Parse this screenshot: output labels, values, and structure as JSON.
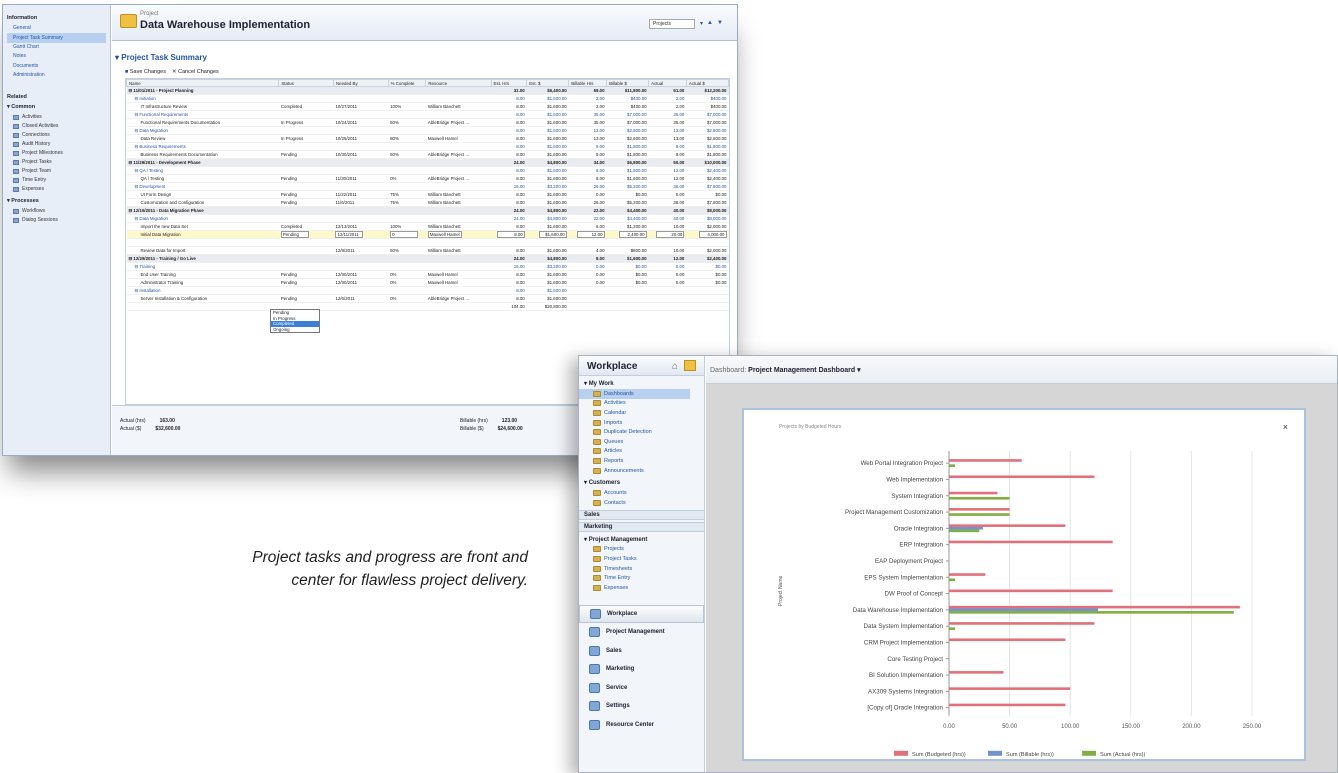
{
  "left_window": {
    "nav": {
      "information_header": "Information",
      "information_items": [
        "General",
        "Project Task Summary",
        "Gantt Chart",
        "Notes",
        "Documents",
        "Administration"
      ],
      "related_header": "Related",
      "common_header": "Common",
      "common_items": [
        "Activities",
        "Closed Activities",
        "Connections",
        "Audit History",
        "Project Milestones",
        "Project Tasks",
        "Project Team",
        "Time Entry",
        "Expenses"
      ],
      "processes_header": "Processes",
      "processes_items": [
        "Workflows",
        "Dialog Sessions"
      ]
    },
    "header": {
      "entity": "Project",
      "title": "Data Warehouse Implementation",
      "view_select": "Projects"
    },
    "section_title": "Project Task Summary",
    "toolbar": {
      "save": "Save Changes",
      "cancel": "Cancel Changes"
    },
    "columns": [
      "Name",
      "Status",
      "Needed By",
      "% Complete",
      "Resource",
      "Est. Hrs",
      "Est. $",
      "Billable Hrs",
      "Billable $",
      "Actual",
      "Actual $"
    ],
    "rows": [
      {
        "kind": "phase",
        "cells": [
          "11/01/2011 - Project Planning",
          "",
          "",
          "",
          "",
          "32.00",
          "$6,400.00",
          "59.00",
          "$11,800.00",
          "61.00",
          "$12,200.00"
        ]
      },
      {
        "kind": "group",
        "cells": [
          "Initiation",
          "",
          "",
          "",
          "",
          "8.00",
          "$1,600.00",
          "2.00",
          "$400.00",
          "2.00",
          "$400.00"
        ]
      },
      {
        "kind": "task",
        "cells": [
          "IT Infrastructure Review",
          "Completed",
          "10/27/2011",
          "100%",
          "William Banchett",
          "8.00",
          "$1,600.00",
          "2.00",
          "$400.00",
          "2.00",
          "$400.00"
        ]
      },
      {
        "kind": "group",
        "cells": [
          "Functional Requirements",
          "",
          "",
          "",
          "",
          "8.00",
          "$1,600.00",
          "35.00",
          "$7,000.00",
          "35.00",
          "$7,000.00"
        ]
      },
      {
        "kind": "task",
        "cells": [
          "Functional Requirements Documentation",
          "In Progress",
          "10/24/2011",
          "50%",
          "AbleBridge Project ...",
          "8.00",
          "$1,600.00",
          "35.00",
          "$7,000.00",
          "35.00",
          "$7,000.00"
        ]
      },
      {
        "kind": "group",
        "cells": [
          "Data Migration",
          "",
          "",
          "",
          "",
          "8.00",
          "$1,600.00",
          "13.00",
          "$2,600.00",
          "13.00",
          "$2,600.00"
        ]
      },
      {
        "kind": "task",
        "cells": [
          "Data Review",
          "In Progress",
          "10/25/2011",
          "80%",
          "Maxwell Hamel",
          "8.00",
          "$1,600.00",
          "13.00",
          "$2,600.00",
          "13.00",
          "$2,600.00"
        ]
      },
      {
        "kind": "group",
        "cells": [
          "Business Requirements",
          "",
          "",
          "",
          "",
          "8.00",
          "$1,600.00",
          "9.00",
          "$1,800.00",
          "9.00",
          "$1,800.00"
        ]
      },
      {
        "kind": "task",
        "cells": [
          "Business Requirements Documentation",
          "Pending",
          "10/30/2011",
          "50%",
          "AbleBridge Project ...",
          "8.00",
          "$1,600.00",
          "9.00",
          "$1,800.00",
          "9.00",
          "$1,800.00"
        ]
      },
      {
        "kind": "phase",
        "cells": [
          "11/29/2011 - Development Phase",
          "",
          "",
          "",
          "",
          "24.00",
          "$4,800.00",
          "34.00",
          "$6,800.00",
          "50.00",
          "$10,000.00"
        ]
      },
      {
        "kind": "group",
        "cells": [
          "QA / Testing",
          "",
          "",
          "",
          "",
          "8.00",
          "$1,600.00",
          "8.00",
          "$1,600.00",
          "12.00",
          "$2,400.00"
        ]
      },
      {
        "kind": "task",
        "cells": [
          "QA / Testing",
          "Pending",
          "11/30/2011",
          "0%",
          "AbleBridge Project ...",
          "8.00",
          "$1,600.00",
          "8.00",
          "$1,600.00",
          "12.00",
          "$2,400.00"
        ]
      },
      {
        "kind": "group",
        "cells": [
          "Development",
          "",
          "",
          "",
          "",
          "16.00",
          "$3,200.00",
          "26.00",
          "$5,200.00",
          "38.00",
          "$7,600.00"
        ]
      },
      {
        "kind": "task",
        "cells": [
          "UI Form Design",
          "Pending",
          "11/22/2011",
          "75%",
          "William Banchett",
          "8.00",
          "$1,600.00",
          "0.00",
          "$0.00",
          "0.00",
          "$0.00"
        ]
      },
      {
        "kind": "task",
        "cells": [
          "Customization and Configuration",
          "Pending",
          "11/6/2011",
          "75%",
          "William Banchett",
          "8.00",
          "$1,600.00",
          "26.00",
          "$5,200.00",
          "38.00",
          "$7,600.00"
        ]
      },
      {
        "kind": "phase",
        "cells": [
          "12/15/2011 - Data Migration Phase",
          "",
          "",
          "",
          "",
          "24.00",
          "$4,800.00",
          "22.00",
          "$4,400.00",
          "40.00",
          "$8,000.00"
        ]
      },
      {
        "kind": "group",
        "cells": [
          "Data Migration",
          "",
          "",
          "",
          "",
          "24.00",
          "$4,800.00",
          "22.00",
          "$4,400.00",
          "40.00",
          "$8,000.00"
        ]
      },
      {
        "kind": "task",
        "cells": [
          "Import the new Data Set",
          "Completed",
          "12/13/2011",
          "100%",
          "William Banchett",
          "8.00",
          "$1,600.00",
          "6.00",
          "$1,200.00",
          "10.00",
          "$2,000.00"
        ]
      },
      {
        "kind": "edit",
        "cells": [
          "Initial Data Migration",
          "Pending",
          "12/11/2011",
          "0",
          "Maxwell Hamel",
          "8.00",
          "$1,600.00",
          "12.00",
          "2,400.00",
          "20.00",
          "4,000.00"
        ]
      },
      {
        "kind": "blank",
        "cells": [
          "",
          "",
          "",
          "",
          "",
          "",
          "",
          "",
          "",
          "",
          ""
        ]
      },
      {
        "kind": "task",
        "cells": [
          "Review Data for Import",
          "",
          "12/8/2011",
          "50%",
          "William Banchett",
          "8.00",
          "$1,600.00",
          "4.00",
          "$800.00",
          "10.00",
          "$2,000.00"
        ]
      },
      {
        "kind": "phase",
        "cells": [
          "12/29/2011 - Training / Go Live",
          "",
          "",
          "",
          "",
          "24.00",
          "$4,800.00",
          "8.00",
          "$1,600.00",
          "12.00",
          "$2,400.00"
        ]
      },
      {
        "kind": "group",
        "cells": [
          "Training",
          "",
          "",
          "",
          "",
          "16.00",
          "$3,200.00",
          "0.00",
          "$0.00",
          "0.00",
          "$0.00"
        ]
      },
      {
        "kind": "task",
        "cells": [
          "End User Training",
          "Pending",
          "12/30/2011",
          "0%",
          "Maxwell Hamel",
          "8.00",
          "$1,600.00",
          "0.00",
          "$0.00",
          "0.00",
          "$0.00"
        ]
      },
      {
        "kind": "task",
        "cells": [
          "Administrator Training",
          "Pending",
          "12/30/2011",
          "0%",
          "Maxwell Hamel",
          "8.00",
          "$1,600.00",
          "0.00",
          "$0.00",
          "0.00",
          "$0.00"
        ]
      },
      {
        "kind": "group",
        "cells": [
          "Installation",
          "",
          "",
          "",
          "",
          "8.00",
          "$1,600.00",
          "",
          "",
          "",
          ""
        ]
      },
      {
        "kind": "task",
        "cells": [
          "Server Installation & Configuration",
          "Pending",
          "12/6/2011",
          "0%",
          "AbleBridge Project ...",
          "8.00",
          "$1,600.00",
          "",
          "",
          "",
          ""
        ]
      },
      {
        "kind": "total",
        "cells": [
          "",
          "",
          "",
          "",
          "",
          "104.00",
          "$20,800.00",
          "",
          "",
          "",
          ""
        ]
      }
    ],
    "status_options": [
      "Pending",
      "In Progress",
      "Completed",
      "Ongoing"
    ],
    "footer": {
      "actual_hrs_label": "Actual (hrs)",
      "actual_hrs": "163.00",
      "actual_usd_label": "Actual ($)",
      "actual_usd": "$32,600.00",
      "billable_hrs_label": "Billable (hrs)",
      "billable_hrs": "123.00",
      "billable_usd_label": "Billable ($)",
      "billable_usd": "$24,600.00"
    }
  },
  "caption": {
    "line1": "Project tasks and progress are front and",
    "line2": "center for flawless project delivery."
  },
  "right_window": {
    "nav": {
      "title": "Workplace",
      "my_work_header": "My Work",
      "my_work_items": [
        "Dashboards",
        "Activities",
        "Calendar",
        "Imports",
        "Duplicate Detection",
        "Queues",
        "Articles",
        "Reports",
        "Announcements"
      ],
      "customers_header": "Customers",
      "customers_items": [
        "Accounts",
        "Contacts"
      ],
      "sales_bar": "Sales",
      "marketing_bar": "Marketing",
      "pm_header": "Project Management",
      "pm_items": [
        "Projects",
        "Project Tasks",
        "Timesheets",
        "Time Entry",
        "Expenses"
      ],
      "bottom_nav": [
        "Workplace",
        "Project Management",
        "Sales",
        "Marketing",
        "Service",
        "Settings",
        "Resource Center"
      ]
    },
    "dashboard_label": "Dashboard:",
    "dashboard_name": "Project Management Dashboard",
    "chart_title": "Projects by Budgeted Hours",
    "close": "×"
  },
  "colors": {
    "budgeted": "#e0707a",
    "billable": "#7393cf",
    "actual": "#7fae42"
  },
  "chart_data": {
    "type": "bar",
    "orientation": "horizontal",
    "title": "Projects by Budgeted Hours",
    "ylabel": "Project Name",
    "xlabel": "",
    "xlim": [
      0,
      250
    ],
    "xticks": [
      "0.00",
      "50.00",
      "100.00",
      "150.00",
      "200.00",
      "250.00"
    ],
    "legend_position": "bottom",
    "categories": [
      "Web Portal Integration Project",
      "Web Implementation",
      "System Integration",
      "Project Management Customization",
      "Oracle Integration",
      "ERP Integration",
      "EAP Deployment Project",
      "EPS System Implementation",
      "DW Proof of Concept",
      "Data Warehouse Implementation",
      "Data System Implementation",
      "CRM Project Implementation",
      "Core Testing Project",
      "BI Solution Implementation",
      "AX309 Systems Integration",
      "[Copy of] Oracle Integration"
    ],
    "series": [
      {
        "name": "Sum (Budgeted (hrs))",
        "values": [
          60,
          120,
          40,
          50,
          96,
          135,
          0,
          30,
          135,
          240,
          120,
          96,
          0,
          45,
          100,
          96
        ]
      },
      {
        "name": "Sum (Billable (hrs))",
        "values": [
          0,
          0,
          0,
          0,
          28,
          0,
          0,
          0,
          0,
          123,
          0,
          0,
          0,
          0,
          0,
          0
        ]
      },
      {
        "name": "Sum (Actual (hrs))",
        "values": [
          5,
          0,
          50,
          50,
          25,
          0,
          0,
          5,
          0,
          235,
          5,
          0,
          0,
          0,
          0,
          0
        ]
      }
    ]
  }
}
